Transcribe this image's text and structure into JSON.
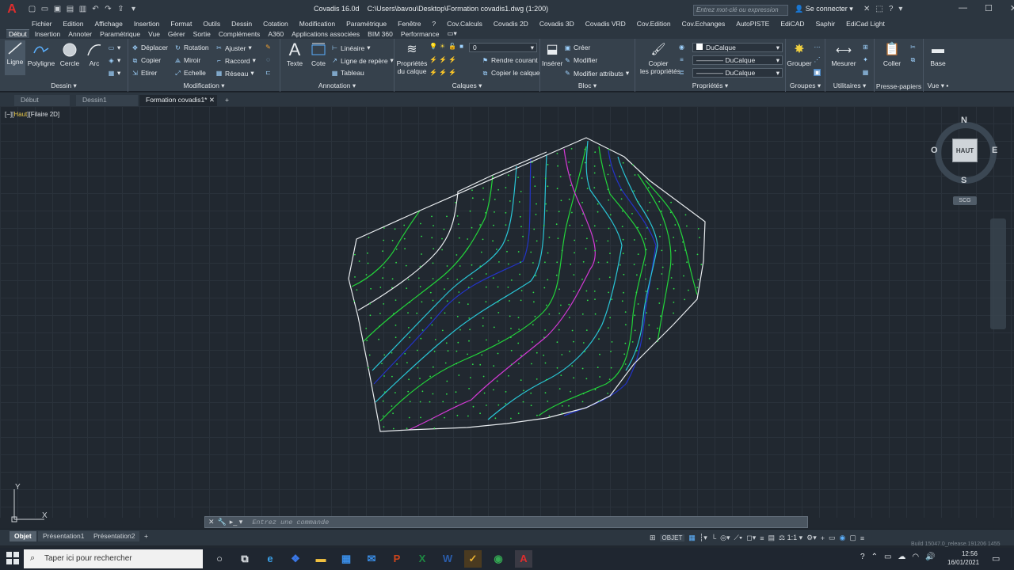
{
  "app": {
    "title": "Covadis 16.0d",
    "file_path": "C:\\Users\\bavou\\Desktop\\Formation covadis1.dwg (1:200)",
    "logo_letter": "A"
  },
  "titlebar": {
    "search_placeholder": "Entrez mot-clé ou expression",
    "signin": "Se connecter",
    "help": "?"
  },
  "menu": [
    "Fichier",
    "Edition",
    "Affichage",
    "Insertion",
    "Format",
    "Outils",
    "Dessin",
    "Cotation",
    "Modification",
    "Paramétrique",
    "Fenêtre",
    "?",
    "Cov.Calculs",
    "Covadis 2D",
    "Covadis 3D",
    "Covadis VRD",
    "Cov.Edition",
    "Cov.Echanges",
    "AutoPISTE",
    "EdiCAD",
    "Saphir",
    "EdiCad Light"
  ],
  "ribbon_tabs": [
    "Début",
    "Insertion",
    "Annoter",
    "Paramétrique",
    "Vue",
    "Gérer",
    "Sortie",
    "Compléments",
    "A360",
    "Applications associées",
    "BIM 360",
    "Performance"
  ],
  "ribbon": {
    "dessin": {
      "title": "Dessin",
      "ligne": "Ligne",
      "polyligne": "Polyligne",
      "cercle": "Cercle",
      "arc": "Arc"
    },
    "modification": {
      "title": "Modification",
      "deplacer": "Déplacer",
      "rotation": "Rotation",
      "ajuster": "Ajuster",
      "copier": "Copier",
      "miroir": "Miroir",
      "raccord": "Raccord",
      "etirer": "Etirer",
      "echelle": "Echelle",
      "reseau": "Réseau"
    },
    "annotation": {
      "title": "Annotation",
      "texte": "Texte",
      "cote": "Cote",
      "lineaire": "Linéaire",
      "ligne_repere": "Ligne de repère",
      "tableau": "Tableau"
    },
    "calques": {
      "title": "Calques",
      "proprietes_l1": "Propriétés",
      "proprietes_l2": "du calque",
      "layer_value": "0",
      "rendre_courant": "Rendre courant",
      "copier_calque": "Copier le calque"
    },
    "bloc": {
      "title": "Bloc",
      "inserer": "Insérer",
      "creer": "Créer",
      "modifier": "Modifier",
      "modifier_attributs": "Modifier attributs"
    },
    "proprietes": {
      "title": "Propriétés",
      "copier_l1": "Copier",
      "copier_l2": "les propriétés",
      "color": "DuCalque",
      "linetype": "DuCalque",
      "lineweight": "DuCalque"
    },
    "groupes": {
      "title": "Groupes",
      "grouper": "Grouper"
    },
    "utilitaires": {
      "title": "Utilitaires",
      "mesurer": "Mesurer"
    },
    "presse_papiers": {
      "title": "Presse-papiers",
      "coller": "Coller"
    },
    "vue": {
      "title": "Vue",
      "base": "Base"
    }
  },
  "doc_tabs": [
    "Début",
    "Dessin1",
    "Formation covadis1*"
  ],
  "viewport": {
    "label_pre": "[−][",
    "label_view": "Haut",
    "label_post": "][Filaire 2D]"
  },
  "viewcube": {
    "n": "N",
    "s": "S",
    "e": "E",
    "o": "O",
    "face": "HAUT",
    "ucs": "SCG"
  },
  "ucs": {
    "x": "X",
    "y": "Y"
  },
  "command_placeholder": "Entrez une commande",
  "layout_tabs": [
    "Objet",
    "Présentation1",
    "Présentation2"
  ],
  "status": {
    "mode": "OBJET",
    "scale": "1:1"
  },
  "build": "Build 15047.0_release.191206 1455",
  "taskbar": {
    "search": "Taper ici pour rechercher",
    "time": "12:56",
    "date": "16/01/2021"
  },
  "colors": {
    "boundary": "#e8ecef",
    "contour_green": "#22d43a",
    "contour_cyan": "#29c6d6",
    "contour_blue": "#2233c8",
    "contour_magenta": "#d43ad6",
    "points": "#2ee04a"
  }
}
